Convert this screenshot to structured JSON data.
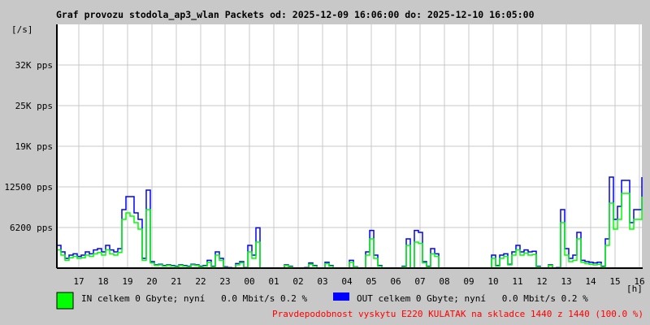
{
  "chart_data": {
    "type": "line",
    "title": "Graf provozu stodola_ap3_wlan Packets od: 2025-12-09 16:06:00 do: 2025-12-10 16:05:00",
    "ylabel": "[/s]",
    "xlabel": "[h]",
    "ylim": [
      0,
      37500
    ],
    "grid": true,
    "sample_interval_min": 10,
    "start_time": "16:06",
    "yticks": [
      {
        "value": 6250,
        "label": "6200 pps"
      },
      {
        "value": 12500,
        "label": "12500 pps"
      },
      {
        "value": 18750,
        "label": "19K pps"
      },
      {
        "value": 25000,
        "label": "25K pps"
      },
      {
        "value": 31250,
        "label": "32K pps"
      }
    ],
    "xticks": [
      "17",
      "18",
      "19",
      "20",
      "21",
      "22",
      "23",
      "00",
      "01",
      "02",
      "03",
      "04",
      "05",
      "06",
      "07",
      "08",
      "09",
      "10",
      "11",
      "12",
      "13",
      "14",
      "15",
      "16"
    ],
    "series": [
      {
        "name": "OUT",
        "color": "#0000ff",
        "values": [
          3500,
          2500,
          1500,
          2000,
          2200,
          1800,
          2000,
          2500,
          2200,
          2800,
          3000,
          2500,
          3500,
          2800,
          2500,
          3000,
          9000,
          11000,
          11000,
          8500,
          7500,
          1500,
          12000,
          1000,
          500,
          600,
          400,
          500,
          400,
          300,
          500,
          400,
          300,
          600,
          500,
          300,
          400,
          1200,
          300,
          2500,
          1500,
          200,
          100,
          0,
          700,
          1000,
          100,
          3500,
          2000,
          6200,
          0,
          0,
          0,
          0,
          0,
          0,
          500,
          300,
          0,
          0,
          0,
          100,
          800,
          400,
          0,
          0,
          900,
          400,
          0,
          0,
          0,
          0,
          1200,
          200,
          0,
          0,
          2500,
          5800,
          2000,
          400,
          0,
          0,
          0,
          0,
          0,
          300,
          4500,
          0,
          5800,
          5500,
          1000,
          300,
          3000,
          2200,
          0,
          0,
          0,
          0,
          0,
          0,
          0,
          0,
          0,
          0,
          0,
          0,
          0,
          2000,
          400,
          2000,
          2200,
          600,
          2500,
          3500,
          2500,
          2800,
          2500,
          2600,
          300,
          0,
          0,
          500,
          0,
          100,
          9000,
          3000,
          1500,
          2000,
          5500,
          1200,
          1000,
          900,
          800,
          900,
          300,
          4500,
          14000,
          7500,
          9500,
          13500,
          13500,
          7000,
          9000,
          9000,
          14000
        ]
      },
      {
        "name": "IN",
        "color": "#00ff00",
        "values": [
          2800,
          2000,
          1200,
          1600,
          1800,
          1500,
          1600,
          2000,
          1800,
          2200,
          2400,
          2000,
          2800,
          2200,
          2000,
          2400,
          7500,
          8500,
          8000,
          7000,
          6000,
          1200,
          9000,
          800,
          400,
          500,
          300,
          400,
          300,
          200,
          400,
          300,
          200,
          500,
          400,
          200,
          300,
          900,
          200,
          2000,
          1200,
          100,
          50,
          0,
          500,
          800,
          50,
          2500,
          1500,
          4000,
          0,
          0,
          0,
          0,
          0,
          0,
          400,
          200,
          0,
          0,
          0,
          50,
          600,
          300,
          0,
          0,
          700,
          300,
          0,
          0,
          0,
          0,
          900,
          150,
          0,
          0,
          2000,
          4500,
          1500,
          300,
          0,
          0,
          0,
          0,
          0,
          200,
          3500,
          0,
          4000,
          3800,
          800,
          200,
          2200,
          1800,
          0,
          0,
          0,
          0,
          0,
          0,
          0,
          0,
          0,
          0,
          0,
          0,
          0,
          1500,
          300,
          1500,
          1800,
          500,
          2000,
          2800,
          2000,
          2300,
          2000,
          2100,
          200,
          0,
          0,
          400,
          0,
          50,
          7000,
          2000,
          1000,
          1200,
          4500,
          900,
          700,
          600,
          500,
          600,
          200,
          3500,
          10000,
          6000,
          7500,
          11500,
          11500,
          6000,
          7500,
          7500,
          11000
        ]
      }
    ],
    "legend": {
      "in_text": "IN celkem 0 Gbyte; nyní   0.0 Mbit/s 0.2 %",
      "out_text": "OUT celkem 0 Gbyte; nyní   0.0 Mbit/s 0.2 %",
      "in_color": "#00ff00",
      "out_color": "#0000ff"
    },
    "footer": "Pravdepodobnost vyskytu E220 KULATAK na skladce 1440 z 1440 (100.0 %)"
  }
}
